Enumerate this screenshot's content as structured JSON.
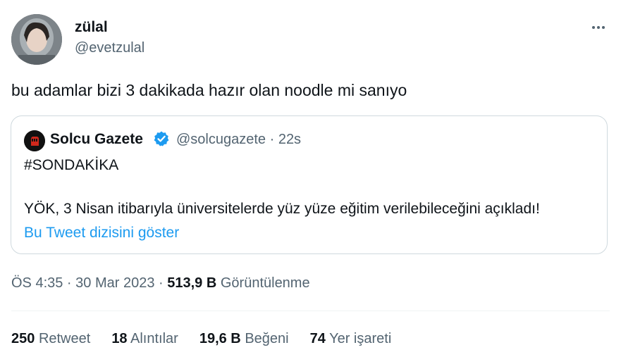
{
  "author": {
    "display_name": "zülal",
    "handle": "@evetzulal"
  },
  "tweet": {
    "text": "bu adamlar bizi 3 dakikada hazır olan noodle mi sanıyo"
  },
  "quoted": {
    "display_name": "Solcu Gazete",
    "handle_time": "@solcugazete · 22s",
    "line1": "#SONDAKİKA",
    "line2": "YÖK, 3 Nisan itibarıyla üniversitelerde yüz yüze eğitim verilebileceğini açıkladı!",
    "show_thread": "Bu Tweet dizisini göster"
  },
  "meta": {
    "time_date": "ÖS 4:35 · 30 Mar 2023 · ",
    "views_count": "513,9 B",
    "views_label": " Görüntülenme"
  },
  "stats": [
    {
      "count": "250",
      "label": "Retweet"
    },
    {
      "count": "18",
      "label": "Alıntılar"
    },
    {
      "count": "19,6 B",
      "label": "Beğeni"
    },
    {
      "count": "74",
      "label": "Yer işareti"
    }
  ],
  "colors": {
    "link": "#1d9bf0",
    "secondary_text": "#536471",
    "primary_text": "#0f1419",
    "border": "#cfd9de",
    "verified": "#1d9bf0"
  },
  "icons": [
    "more-icon",
    "verified-badge-icon",
    "fist-logo-icon"
  ]
}
